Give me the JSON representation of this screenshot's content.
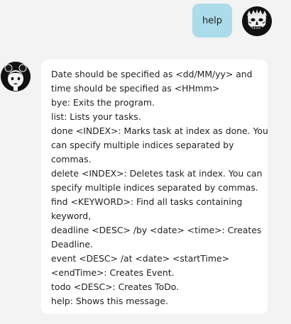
{
  "user_message": {
    "text": "help"
  },
  "bot_message": {
    "lines": [
      "Date should be specified as <dd/MM/yy> and",
      "time should be specified as <HHmm>",
      "bye: Exits the program.",
      "list: Lists your tasks.",
      "done <INDEX>: Marks task at index as done. You",
      "can specify multiple indices separated by",
      "commas.",
      "delete <INDEX>: Deletes task at index. You can",
      "specify multiple indices separated by commas.",
      "find <KEYWORD>: Find all tasks containing",
      "keyword,",
      "deadline <DESC> /by <date> <time>: Creates",
      "Deadline.",
      "event <DESC> /at <date> <startTime>",
      "<endTime>: Creates Event.",
      "todo <DESC>: Creates ToDo.",
      "help: Shows this message."
    ]
  },
  "colors": {
    "user_bubble": "#acdbe9",
    "bot_bubble": "#ffffff",
    "background": "#f3f3f3"
  },
  "icons": {
    "user_avatar": "tribal-mask-avatar-icon",
    "bot_avatar": "girl-face-avatar-icon"
  }
}
